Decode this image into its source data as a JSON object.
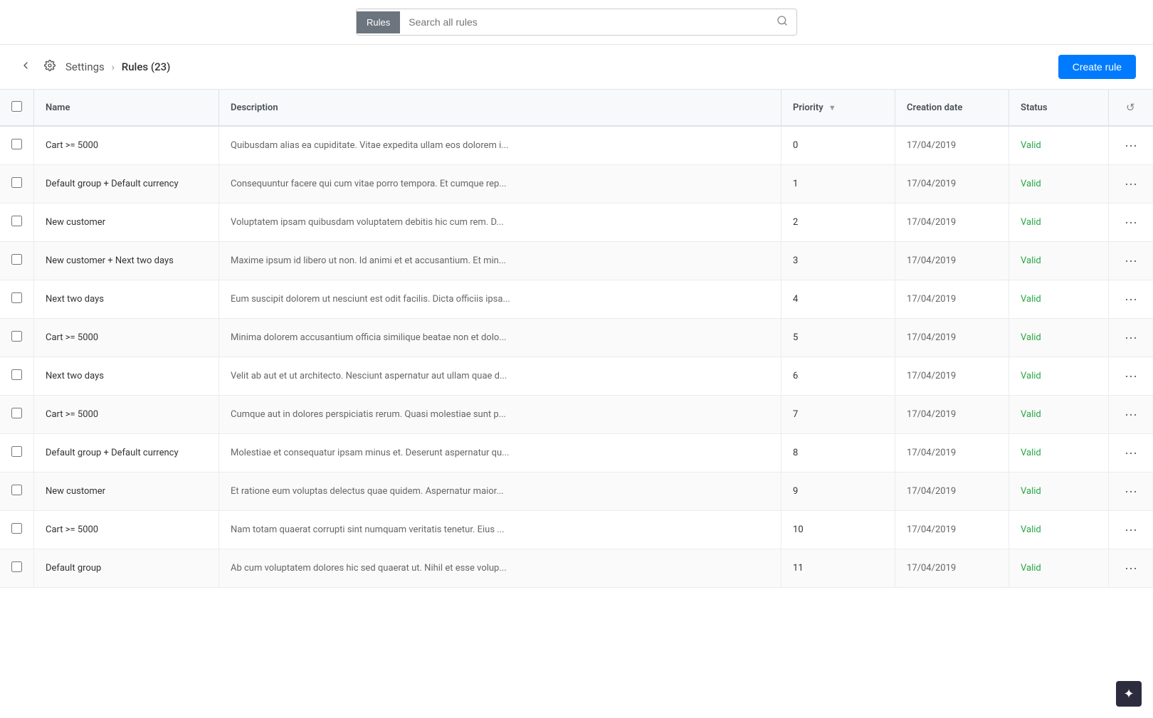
{
  "topBar": {
    "rules_btn_label": "Rules",
    "search_placeholder": "Search all rules",
    "search_icon": "🔍"
  },
  "header": {
    "breadcrumb_settings": "Settings",
    "breadcrumb_sep": "›",
    "breadcrumb_current": "Rules",
    "rules_count": "(23)",
    "create_btn_label": "Create rule",
    "reload_icon": "↺"
  },
  "table": {
    "columns": [
      {
        "key": "check",
        "label": ""
      },
      {
        "key": "name",
        "label": "Name"
      },
      {
        "key": "description",
        "label": "Description"
      },
      {
        "key": "priority",
        "label": "Priority"
      },
      {
        "key": "creation_date",
        "label": "Creation date"
      },
      {
        "key": "status",
        "label": "Status"
      },
      {
        "key": "actions",
        "label": ""
      }
    ],
    "rows": [
      {
        "name": "Cart >= 5000",
        "description": "Quibusdam alias ea cupiditate. Vitae expedita ullam eos dolorem i...",
        "priority": "0",
        "creation_date": "17/04/2019",
        "status": "Valid"
      },
      {
        "name": "Default group + Default currency",
        "description": "Consequuntur facere qui cum vitae porro tempora. Et cumque rep...",
        "priority": "1",
        "creation_date": "17/04/2019",
        "status": "Valid"
      },
      {
        "name": "New customer",
        "description": "Voluptatem ipsam quibusdam voluptatem debitis hic cum rem. D...",
        "priority": "2",
        "creation_date": "17/04/2019",
        "status": "Valid"
      },
      {
        "name": "New customer + Next two days",
        "description": "Maxime ipsum id libero ut non. Id animi et et accusantium. Et min...",
        "priority": "3",
        "creation_date": "17/04/2019",
        "status": "Valid"
      },
      {
        "name": "Next two days",
        "description": "Eum suscipit dolorem ut nesciunt est odit facilis. Dicta officiis ipsa...",
        "priority": "4",
        "creation_date": "17/04/2019",
        "status": "Valid"
      },
      {
        "name": "Cart >= 5000",
        "description": "Minima dolorem accusantium officia similique beatae non et dolo...",
        "priority": "5",
        "creation_date": "17/04/2019",
        "status": "Valid"
      },
      {
        "name": "Next two days",
        "description": "Velit ab aut et ut architecto. Nesciunt aspernatur aut ullam quae d...",
        "priority": "6",
        "creation_date": "17/04/2019",
        "status": "Valid"
      },
      {
        "name": "Cart >= 5000",
        "description": "Cumque aut in dolores perspiciatis rerum. Quasi molestiae sunt p...",
        "priority": "7",
        "creation_date": "17/04/2019",
        "status": "Valid"
      },
      {
        "name": "Default group + Default currency",
        "description": "Molestiae et consequatur ipsam minus et. Deserunt aspernatur qu...",
        "priority": "8",
        "creation_date": "17/04/2019",
        "status": "Valid"
      },
      {
        "name": "New customer",
        "description": "Et ratione eum voluptas delectus quae quidem. Aspernatur maior...",
        "priority": "9",
        "creation_date": "17/04/2019",
        "status": "Valid"
      },
      {
        "name": "Cart >= 5000",
        "description": "Nam totam quaerat corrupti sint numquam veritatis tenetur. Eius ...",
        "priority": "10",
        "creation_date": "17/04/2019",
        "status": "Valid"
      },
      {
        "name": "Default group",
        "description": "Ab cum voluptatem dolores hic sed quaerat ut. Nihil et esse volup...",
        "priority": "11",
        "creation_date": "17/04/2019",
        "status": "Valid"
      }
    ],
    "more_btn_label": "···"
  },
  "bottomRight": {
    "icon": "✦"
  }
}
